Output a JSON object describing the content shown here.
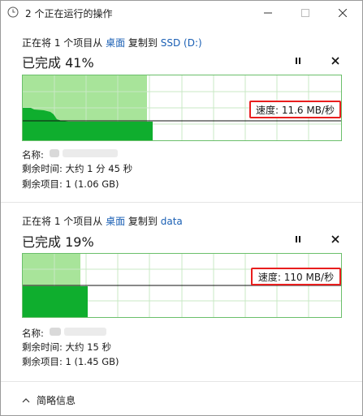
{
  "window": {
    "title": "2 个正在运行的操作"
  },
  "operations": [
    {
      "prefix": "正在将 1 个项目从 ",
      "source": "桌面",
      "middle": " 复制到 ",
      "destination": "SSD (D:)",
      "percent_label": "已完成 41%",
      "progress": 0.41,
      "speed_label": "速度: 11.6 MB/秒",
      "name_label": "名称:",
      "time_left": "剩余时间: 大约 1 分 45 秒",
      "items_left": "剩余项目: 1 (1.06 GB)"
    },
    {
      "prefix": "正在将 1 个项目从 ",
      "source": "桌面",
      "middle": " 复制到 ",
      "destination": "data",
      "percent_label": "已完成 19%",
      "progress": 0.19,
      "speed_label": "速度: 110 MB/秒",
      "name_label": "名称:",
      "time_left": "剩余时间: 大约 15 秒",
      "items_left": "剩余项目: 1 (1.45 GB)"
    }
  ],
  "footer": {
    "toggle_label": "简略信息"
  },
  "colors": {
    "graph_fill": "#0fae2e",
    "graph_progress_bg": "#a8e49a",
    "graph_grid": "#c9e8c4",
    "highlight": "#e81e1e",
    "link": "#1a5fb4"
  }
}
